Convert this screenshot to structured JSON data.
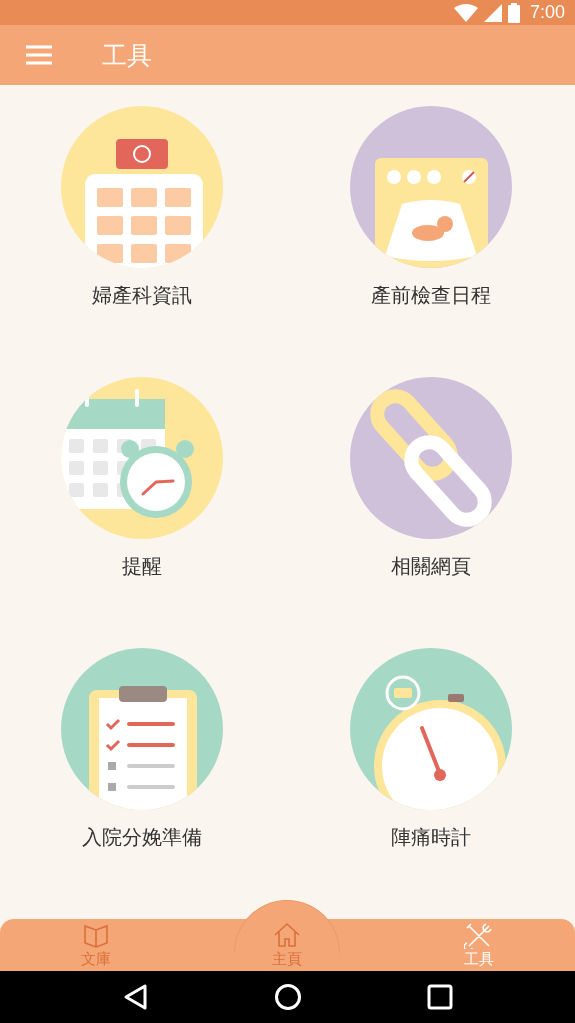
{
  "status_bar": {
    "time": "7:00"
  },
  "app_bar": {
    "title": "工具"
  },
  "tools": [
    {
      "label": "婦產科資訊",
      "kind": "hospital"
    },
    {
      "label": "產前檢查日程",
      "kind": "ultrasound"
    },
    {
      "label": "提醒",
      "kind": "calendar"
    },
    {
      "label": "相關網頁",
      "kind": "link"
    },
    {
      "label": "入院分娩準備",
      "kind": "checklist"
    },
    {
      "label": "陣痛時計",
      "kind": "stopwatch"
    }
  ],
  "bottom_nav": [
    {
      "label": "文庫",
      "kind": "book",
      "selected": false
    },
    {
      "label": "主頁",
      "kind": "home",
      "selected": false
    },
    {
      "label": "工具",
      "kind": "tools",
      "selected": true
    }
  ]
}
